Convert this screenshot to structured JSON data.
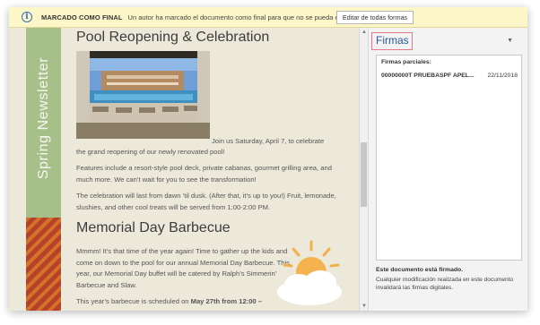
{
  "infobar": {
    "icon": "info-icon",
    "title": "MARCADO COMO FINAL",
    "message": "Un autor ha marcado el documento como final para que no se pueda editar.",
    "button_label": "Editar de todas formas"
  },
  "document": {
    "sidebar_title": "Spring Newsletter",
    "heading1": "Pool Reopening & Celebration",
    "para1_after_photo": "Join us Saturday, April 7, to celebrate",
    "para1_line2": "the grand reopening of our newly renovated pool!",
    "para2": "Features include a resort-style pool deck, private cabanas, gourmet grilling area, and much more. We can’t wait for you to see the transformation!",
    "para3": "The celebration will last from dawn ’til dusk. (After that, it’s up to you!) Fruit, lemonade, slushies, and other cool treats will be served from 1:00-2:00 PM.",
    "heading2": "Memorial Day Barbecue",
    "para4": "Mmmm! It’s that time of the year again! Time to gather up the kids and come on down to the pool for our annual Memorial Day Barbecue. This year, our Memorial Day buffet will be catered by Ralph’s Simmerin’ Barbecue and Slaw.",
    "para5_start": "This year’s barbecue is scheduled on ",
    "para5_bold": "May 27th from 12:00 –"
  },
  "signatures_pane": {
    "title": "Firmas",
    "list_header": "Firmas parciales:",
    "rows": [
      {
        "name": "00000000T PRUEBASPF APEL...",
        "date": "22/11/2018"
      }
    ],
    "footer_bold": "Este documento está firmado.",
    "footer_text": "Cualquier modificación realizada en este documento invalidará las firmas digitales."
  }
}
